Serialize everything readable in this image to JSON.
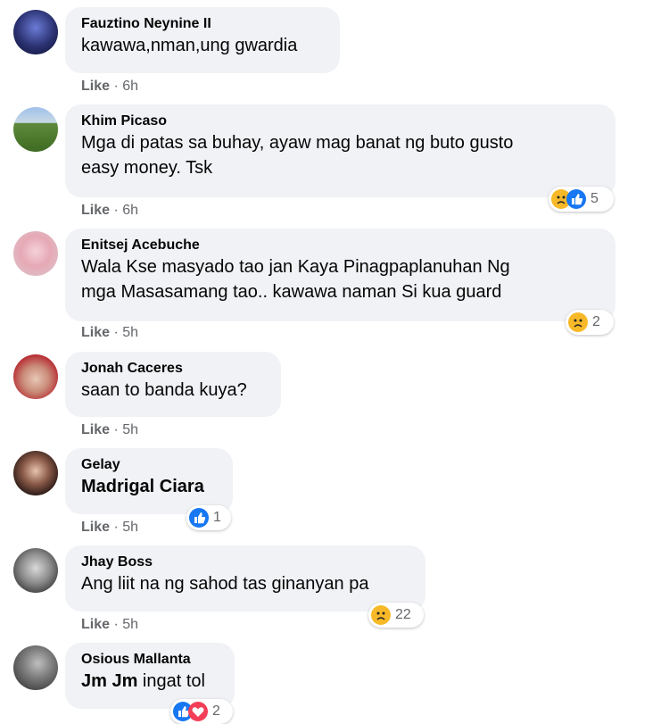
{
  "comments": [
    {
      "author": "Fauztino Neynine II",
      "text": "kawawa,nman,ung gwardia",
      "like": "Like",
      "sep": " · ",
      "time": "6h"
    },
    {
      "author": "Khim Picaso",
      "text": "Mga di patas sa buhay, ayaw mag banat ng buto gusto\neasy money. Tsk",
      "like": "Like",
      "sep": " · ",
      "time": "6h",
      "reaction_count": "5",
      "reaction_icons": [
        "sad-reaction-icon",
        "like-reaction-icon"
      ]
    },
    {
      "author": "Enitsej Acebuche",
      "text": "Wala Kse masyado tao jan Kaya Pinagpaplanuhan Ng\nmga Masasamang tao.. kawawa naman Si kua guard",
      "like": "Like",
      "sep": " · ",
      "time": "5h",
      "reaction_count": "2",
      "reaction_icons": [
        "sad-reaction-icon"
      ]
    },
    {
      "author": "Jonah Caceres",
      "text": "saan to banda kuya?",
      "like": "Like",
      "sep": " · ",
      "time": "5h"
    },
    {
      "author": "Gelay",
      "mention": "Madrigal Ciara",
      "like": "Like",
      "sep": " · ",
      "time": "5h",
      "reaction_count": "1",
      "reaction_icons": [
        "like-reaction-icon"
      ]
    },
    {
      "author": "Jhay Boss",
      "text": "Ang liit na ng sahod tas ginanyan pa",
      "like": "Like",
      "sep": " · ",
      "time": "5h",
      "reaction_count": "22",
      "reaction_icons": [
        "sad-reaction-icon"
      ]
    },
    {
      "author": "Osious Mallanta",
      "mention": "Jm Jm",
      "text": " ingat tol",
      "reaction_count": "2",
      "reaction_icons": [
        "like-reaction-icon",
        "love-reaction-icon"
      ]
    }
  ],
  "colors": {
    "bubble": "#f0f2f5",
    "meta": "#65676b",
    "like_reaction": "#1877f2",
    "sad_reaction": "#f7b928",
    "love_reaction": "#f33e58"
  }
}
